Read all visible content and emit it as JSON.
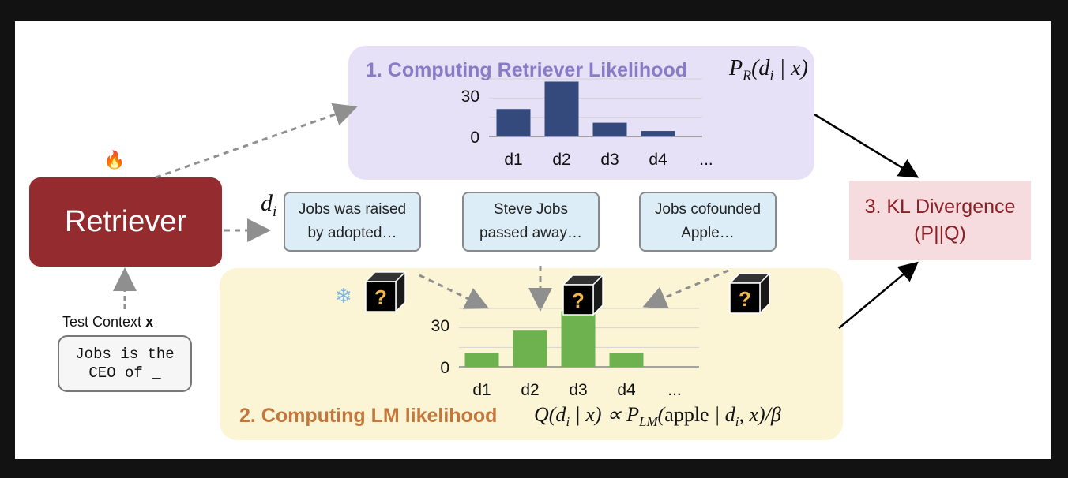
{
  "retriever": {
    "label": "Retriever",
    "fire_icon": "🔥"
  },
  "retriever_chart": {
    "title": "1. Computing Retriever Likelihood",
    "formula": "P_R(d_i | x)"
  },
  "lm_chart": {
    "title": "2. Computing LM likelihood",
    "formula": "Q(d_i | x) ∝ P_LM(apple | d_i, x)/β",
    "snowflake_icon": "❄"
  },
  "docs_label": "d_i",
  "documents": [
    {
      "line1": "Jobs was raised",
      "line2": "by adopted…"
    },
    {
      "line1": "Steve Jobs",
      "line2": "passed away…"
    },
    {
      "line1": "Jobs cofounded",
      "line2": "Apple…"
    }
  ],
  "kl": {
    "line1": "3. KL Divergence",
    "line2": "(P||Q)"
  },
  "test_context": {
    "label": "Test Context",
    "var": "x",
    "line1": "Jobs is the",
    "line2": "CEO of _"
  },
  "black_box_mark": "?",
  "colors": {
    "retriever_bar": "#34497c",
    "lm_bar": "#6eb24f",
    "retriever": "#932b2f"
  },
  "chart_data": [
    {
      "type": "bar",
      "title": "1. Computing Retriever Likelihood",
      "categories": [
        "d1",
        "d2",
        "d3",
        "d4",
        "..."
      ],
      "values": [
        20,
        40,
        10,
        4,
        null
      ],
      "ytick_labels": [
        "0",
        "30"
      ],
      "ylim": [
        0,
        42
      ]
    },
    {
      "type": "bar",
      "title": "2. Computing LM likelihood",
      "categories": [
        "d1",
        "d2",
        "d3",
        "d4",
        "..."
      ],
      "values": [
        10,
        26,
        40,
        10,
        null
      ],
      "ytick_labels": [
        "0",
        "30"
      ],
      "ylim": [
        0,
        42
      ]
    }
  ]
}
